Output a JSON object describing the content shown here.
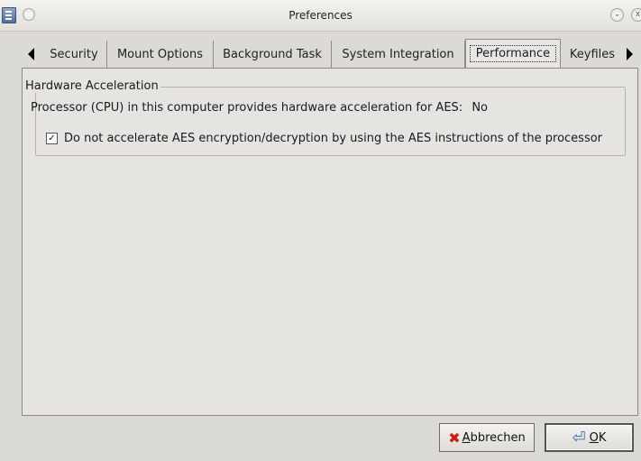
{
  "window": {
    "title": "Preferences",
    "minimize_glyph": "⌄",
    "close_glyph": "x"
  },
  "tabs": [
    {
      "label": "Security",
      "active": false
    },
    {
      "label": "Mount Options",
      "active": false
    },
    {
      "label": "Background Task",
      "active": false
    },
    {
      "label": "System Integration",
      "active": false
    },
    {
      "label": "Performance",
      "active": true
    },
    {
      "label": "Keyfiles",
      "active": false
    }
  ],
  "hardware_acceleration": {
    "group_title": "Hardware Acceleration",
    "status_text": "Processor (CPU) in this computer provides hardware acceleration for AES:",
    "status_value": "No",
    "checkbox_label": "Do not accelerate AES encryption/decryption by using the AES instructions of the processor",
    "checkbox_checked": true,
    "check_glyph": "✓"
  },
  "buttons": {
    "cancel_mnemonic": "A",
    "cancel_rest": "bbrechen",
    "ok_mnemonic": "O",
    "ok_rest": "K"
  },
  "icons": {
    "cancel": "red-x-icon",
    "ok": "return-arrow-icon"
  }
}
